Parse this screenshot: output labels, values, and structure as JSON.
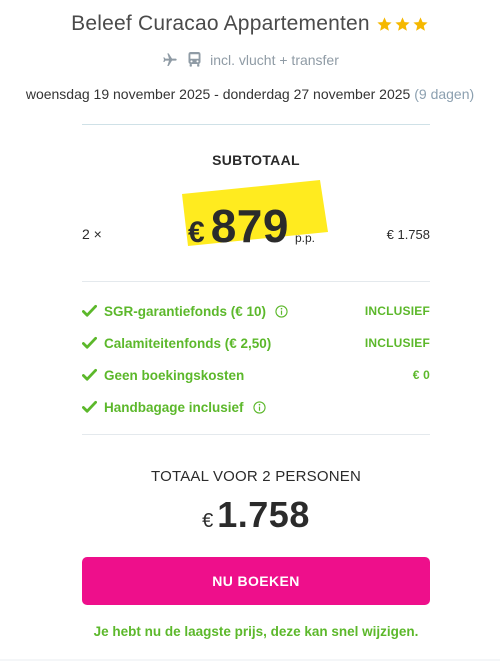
{
  "header": {
    "title": "Beleef Curacao Appartementen",
    "star_count": 3,
    "star_color": "#f5b800",
    "transport_text": "incl. vlucht + transfer",
    "transport_icons": [
      "plane-icon",
      "bus-icon"
    ],
    "dates": "woensdag 19 november 2025 - donderdag 27 november 2025",
    "nights": "(9 dagen)"
  },
  "subtotal": {
    "label": "SUBTOTAAL",
    "quantity": "2 ×",
    "currency": "€",
    "price": "879",
    "per_person": "p.p.",
    "line_total": "€ 1.758",
    "highlight_color": "#ffeb1f"
  },
  "features": [
    {
      "label": "SGR-garantiefonds  (€ 10)",
      "has_info": true,
      "value": "INCLUSIEF"
    },
    {
      "label": "Calamiteitenfonds  (€ 2,50)",
      "has_info": false,
      "value": "INCLUSIEF"
    },
    {
      "label": "Geen boekingskosten",
      "has_info": false,
      "value": "€ 0"
    },
    {
      "label": "Handbagage inclusief",
      "has_info": true,
      "value": ""
    }
  ],
  "total": {
    "label": "TOTAAL VOOR 2 PERSONEN",
    "currency": "€",
    "amount": "1.758"
  },
  "cta": {
    "label": "NU BOEKEN",
    "color": "#ee0f8b"
  },
  "note": "Je hebt nu de laagste prijs, deze kan snel wijzigen.",
  "colors": {
    "accent_green": "#5cb82b",
    "muted_blue": "#8ca0b0"
  }
}
